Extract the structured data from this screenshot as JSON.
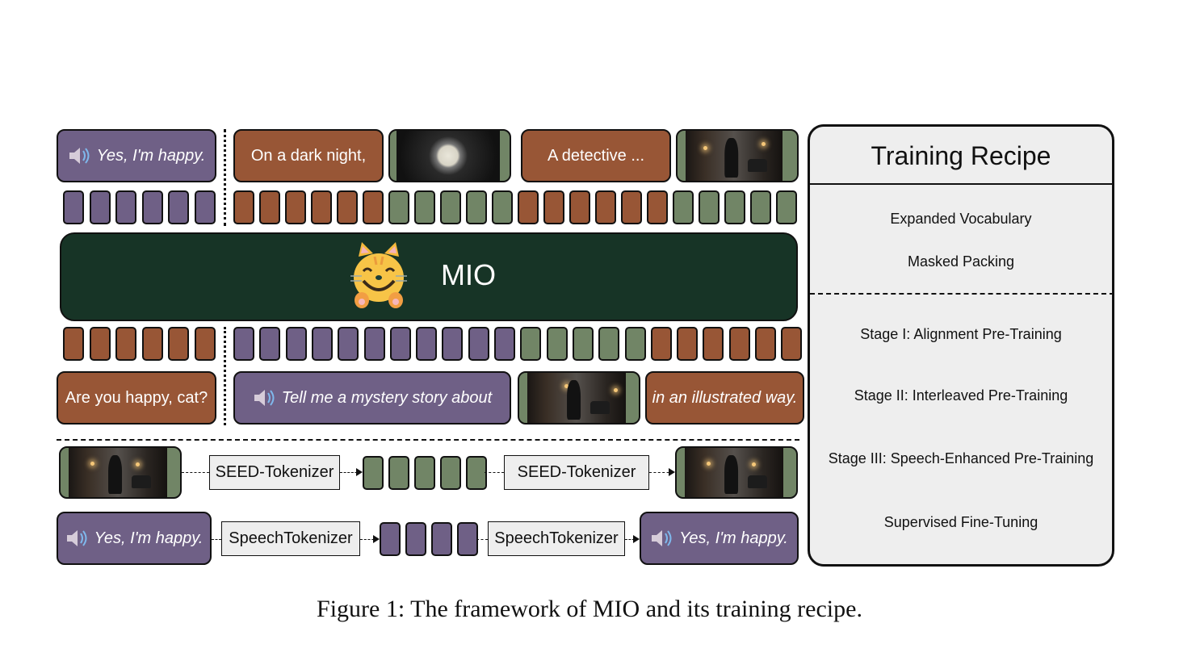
{
  "top_row": {
    "speech_text": "Yes, I'm happy.",
    "text1": "On a dark night,",
    "image1": "moon-image",
    "text2": "A detective ...",
    "image2": "detective-image"
  },
  "top_tokens": {
    "left": [
      "purple",
      "purple",
      "purple",
      "purple",
      "purple",
      "purple"
    ],
    "right": [
      "brown",
      "brown",
      "brown",
      "brown",
      "brown",
      "brown",
      "green",
      "green",
      "green",
      "green",
      "green",
      "brown",
      "brown",
      "brown",
      "brown",
      "brown",
      "brown",
      "green",
      "green",
      "green",
      "green",
      "green"
    ]
  },
  "model": {
    "name": "MIO",
    "icon": "smiling-cat-icon"
  },
  "bottom_tokens": {
    "left": [
      "brown",
      "brown",
      "brown",
      "brown",
      "brown",
      "brown"
    ],
    "right": [
      "purple",
      "purple",
      "purple",
      "purple",
      "purple",
      "purple",
      "purple",
      "purple",
      "purple",
      "purple",
      "purple",
      "green",
      "green",
      "green",
      "green",
      "green",
      "brown",
      "brown",
      "brown",
      "brown",
      "brown",
      "brown"
    ]
  },
  "bottom_row": {
    "text1": "Are you happy, cat?",
    "speech_text": "Tell me a mystery story about",
    "image": "detective-image",
    "text2": "in an illustrated way."
  },
  "tokenizers": {
    "seed": {
      "label_in": "SEED-Tokenizer",
      "label_out": "SEED-Tokenizer",
      "token_count": 5
    },
    "speech": {
      "label_in": "SpeechTokenizer",
      "label_out": "SpeechTokenizer",
      "token_count": 4,
      "speech_text_in": "Yes, I'm happy.",
      "speech_text_out": "Yes, I'm happy."
    }
  },
  "recipe": {
    "title": "Training Recipe",
    "group1": [
      "Expanded Vocabulary",
      "Masked Packing"
    ],
    "group2": [
      "Stage I: Alignment Pre-Training",
      "Stage II: Interleaved Pre-Training",
      "Stage III: Speech-Enhanced Pre-Training",
      "Supervised Fine-Tuning"
    ]
  },
  "colors": {
    "speech": "#6f6086",
    "text": "#985636",
    "image": "#718566",
    "model": "#173426",
    "panel": "#eeeeee"
  },
  "caption": "Figure 1: The framework of MIO and its training recipe."
}
